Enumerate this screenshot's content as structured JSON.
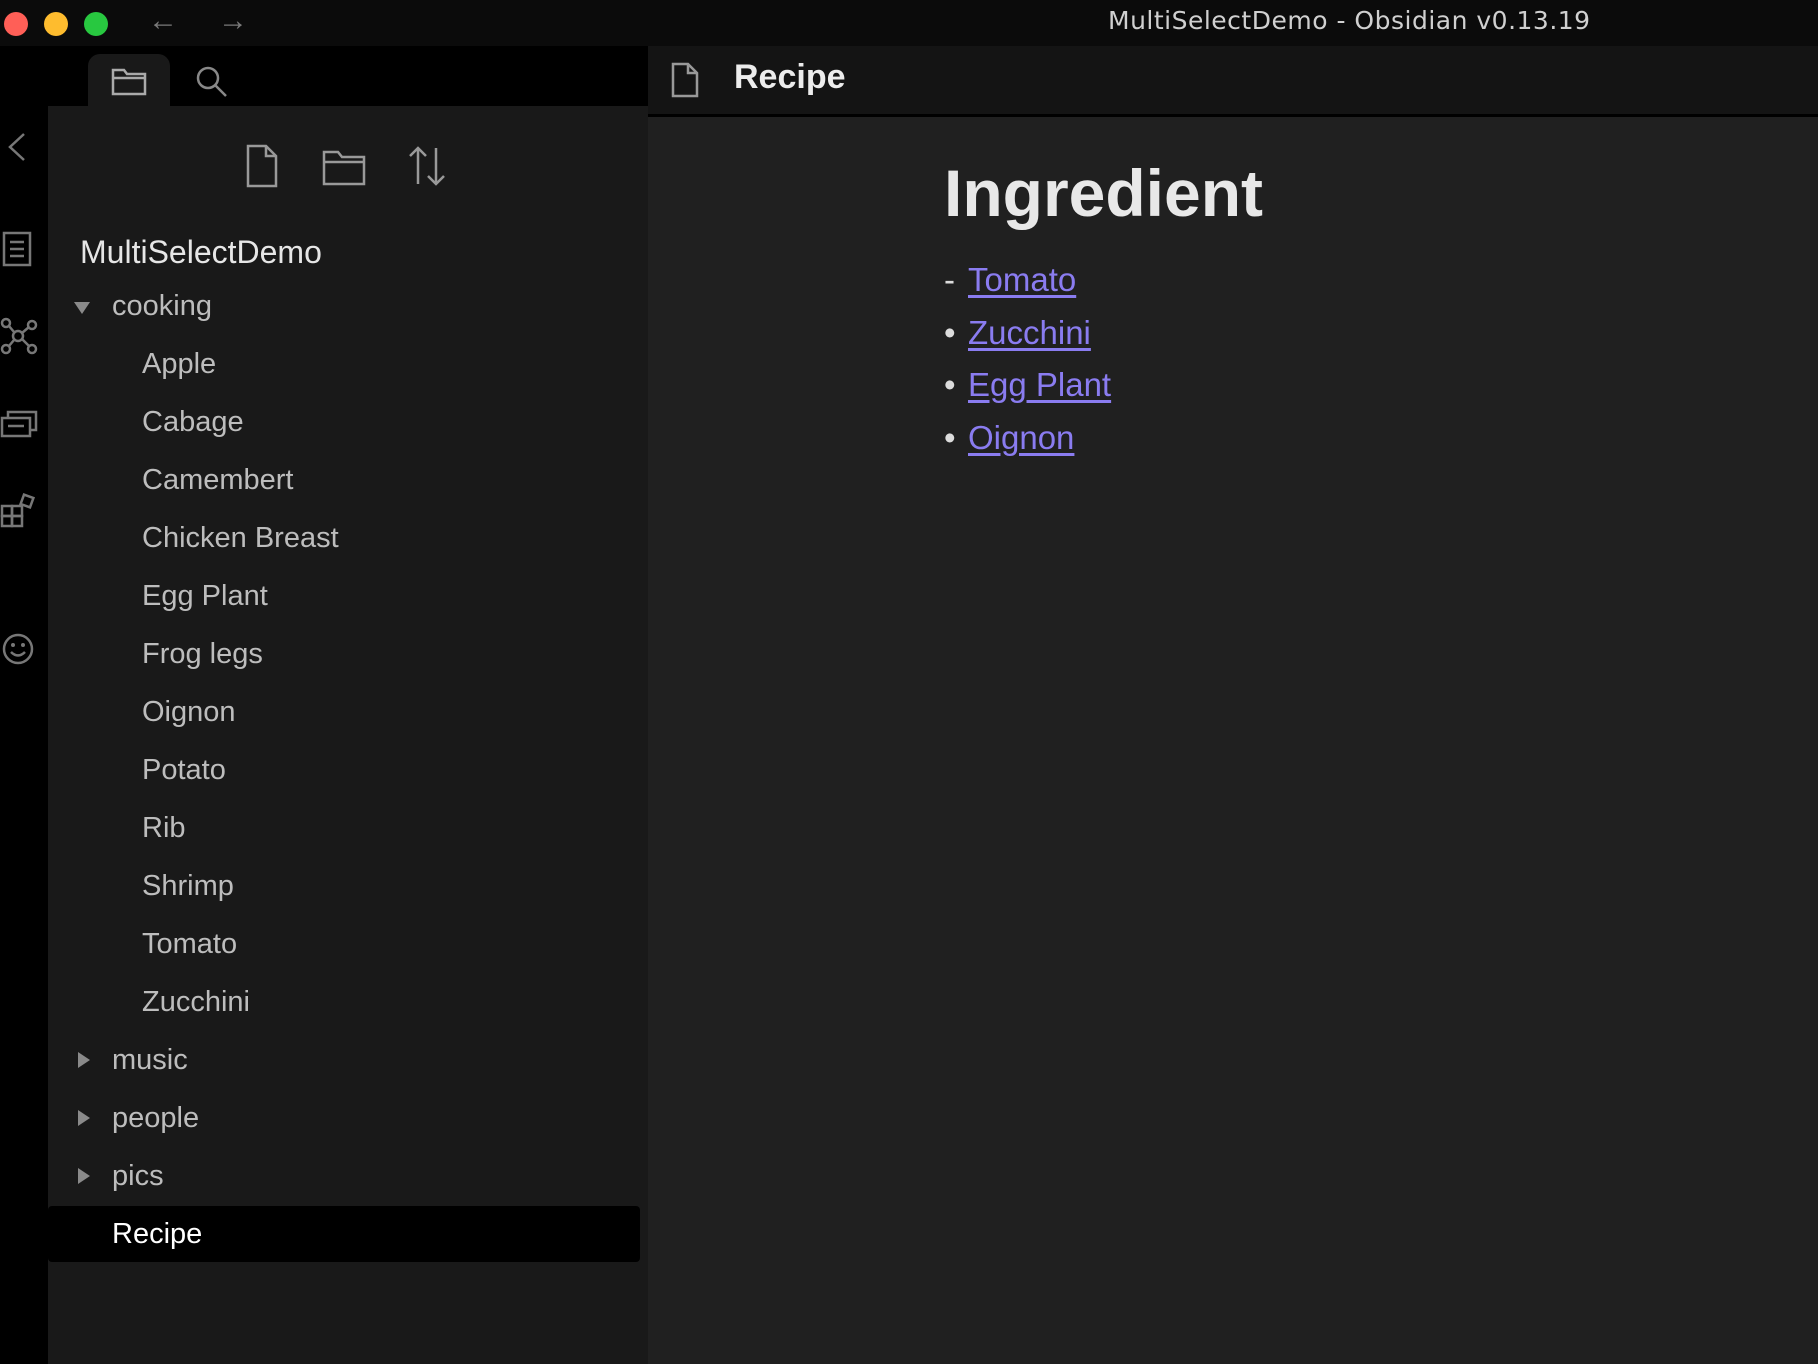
{
  "window": {
    "title": "MultiSelectDemo - Obsidian v0.13.19",
    "nav_back": "←",
    "nav_forward": "→"
  },
  "ribbon": {
    "icons": [
      "collapse-sidebar-icon",
      "open-switcher-icon",
      "graph-view-icon",
      "slides-icon",
      "plugin-grid-icon",
      "emoji-icon"
    ]
  },
  "sidebar": {
    "tabs": [
      "file-explorer",
      "search"
    ],
    "toolbar": [
      "new-note",
      "new-folder",
      "change-sort-order"
    ],
    "vault_name": "MultiSelectDemo",
    "tree": {
      "cooking": {
        "label": "cooking",
        "expanded": true,
        "files": [
          "Apple",
          "Cabage",
          "Camembert",
          "Chicken Breast",
          "Egg Plant",
          "Frog legs",
          "Oignon",
          "Potato",
          "Rib",
          "Shrimp",
          "Tomato",
          "Zucchini"
        ]
      },
      "music": {
        "label": "music",
        "expanded": false
      },
      "people": {
        "label": "people",
        "expanded": false
      },
      "pics": {
        "label": "pics",
        "expanded": false
      },
      "recipe": {
        "label": "Recipe",
        "active": true
      }
    }
  },
  "editor": {
    "tab_title": "Recipe",
    "heading": "Ingredient",
    "list": [
      {
        "marker": "-",
        "text": "Tomato"
      },
      {
        "marker": "•",
        "text": "Zucchini"
      },
      {
        "marker": "•",
        "text": "Egg Plant"
      },
      {
        "marker": "•",
        "text": "Oignon"
      }
    ]
  },
  "colors": {
    "link": "#8a7cf0",
    "background": "#202020",
    "sidebar": "#191919",
    "active_row": "#000000"
  }
}
